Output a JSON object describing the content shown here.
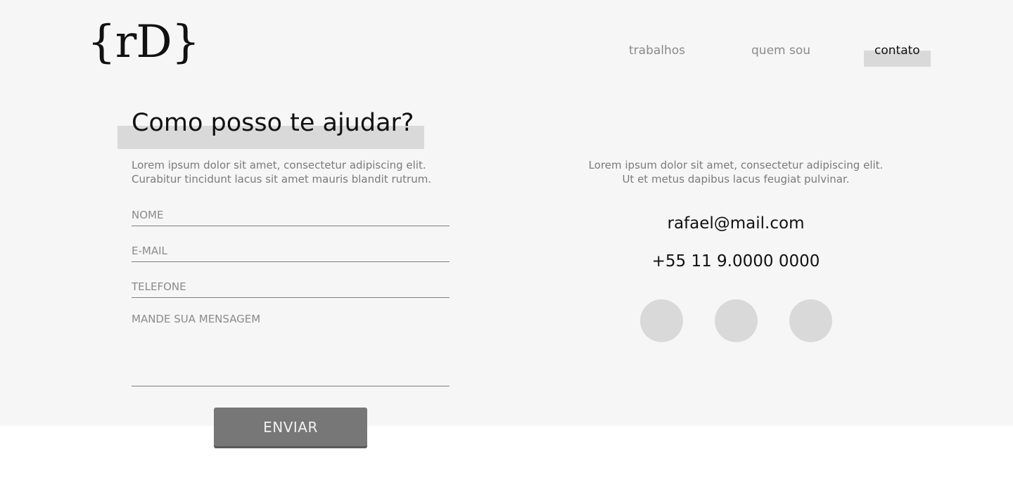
{
  "header": {
    "logo": "{rD}",
    "nav": [
      {
        "label": "trabalhos",
        "active": false
      },
      {
        "label": "quem sou",
        "active": false
      },
      {
        "label": "contato",
        "active": true
      }
    ]
  },
  "form_section": {
    "heading": "Como posso te ajudar?",
    "intro_lines": [
      "Lorem ipsum dolor sit amet, consectetur adipiscing elit.",
      "Curabitur tincidunt lacus sit amet mauris blandit rutrum."
    ],
    "fields": {
      "name_placeholder": "NOME",
      "email_placeholder": "E-MAIL",
      "phone_placeholder": "TELEFONE",
      "message_placeholder": "MANDE SUA MENSAGEM"
    },
    "submit_label": "ENVIAR"
  },
  "contact_section": {
    "desc_lines": [
      "Lorem ipsum dolor sit amet, consectetur adipiscing elit.",
      "Ut et metus dapibus lacus feugiat pulvinar."
    ],
    "email": "rafael@mail.com",
    "phone": "+55 11 9.0000 0000",
    "social_icons": [
      "social-icon-placeholder",
      "social-icon-placeholder",
      "social-icon-placeholder"
    ]
  },
  "colors": {
    "page_background": "#f6f6f6",
    "highlight": "#d9d9d9",
    "button": "#777777",
    "text_dark": "#111111",
    "text_muted": "#7a7a7a"
  }
}
